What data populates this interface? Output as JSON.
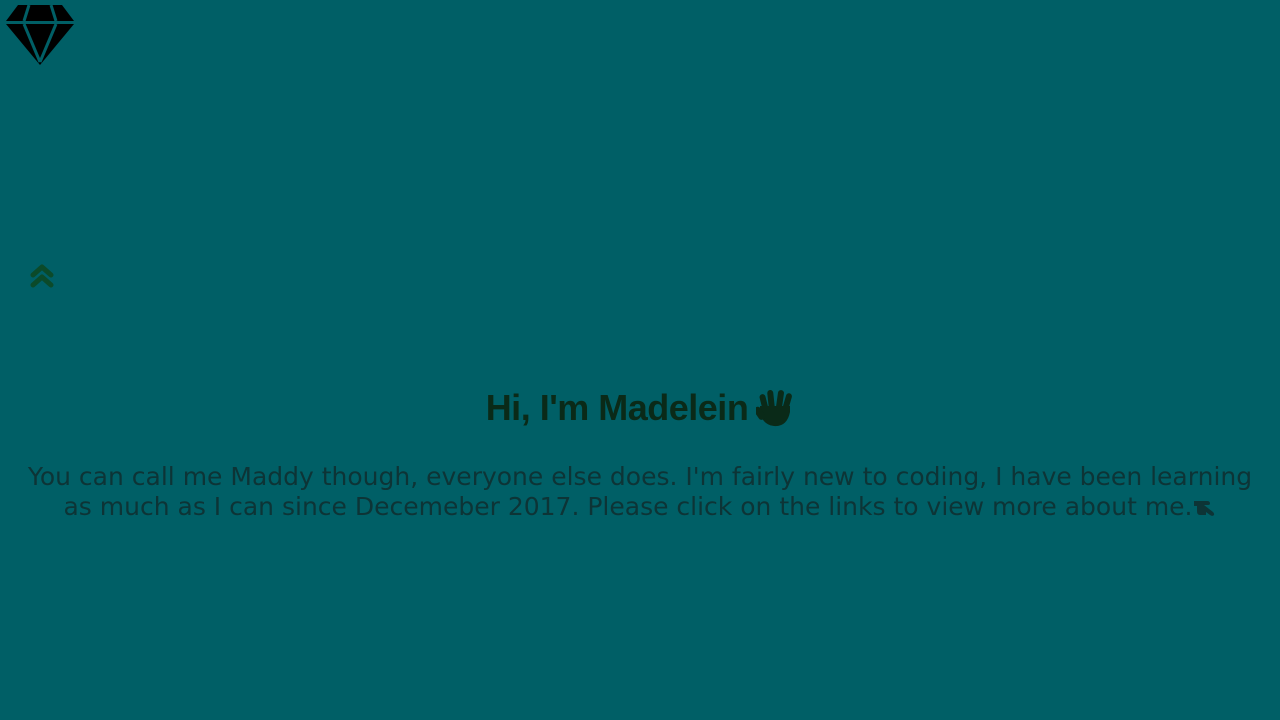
{
  "header": {
    "logo_icon": "diamond-icon",
    "logo_color": "#000000"
  },
  "nav": {
    "scroll_top_icon": "double-chevron-up-icon",
    "icon_color": "#0b4a2a"
  },
  "hero": {
    "title": "Hi, I'm Madelein",
    "title_icon": "vulcan-salute-hand-icon",
    "text": "You can call me Maddy though, everyone else does. I'm fairly new to coding, I have been learning as much as I can since Decemeber 2017. Please click on the links to view more about me.",
    "text_icon": "hand-pointing-right-icon"
  },
  "colors": {
    "background": "#005f66",
    "title": "#0a2a18",
    "text": "#0d3436"
  }
}
